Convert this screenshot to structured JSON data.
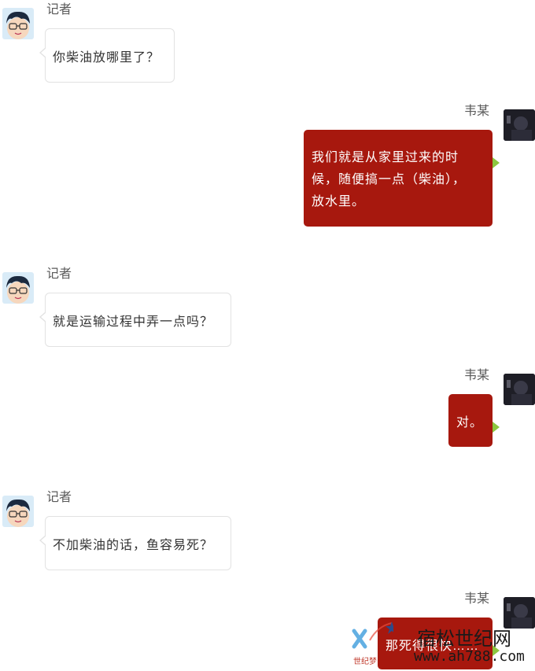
{
  "conversation": {
    "messages": [
      {
        "speaker": "记者",
        "side": "left",
        "lines": [
          "你柴油放哪里了？"
        ]
      },
      {
        "speaker": "韦某",
        "side": "right",
        "lines": [
          "我们就是从家里过来的时",
          "候，随便搞一点（柴油），",
          "放水里。"
        ]
      },
      {
        "speaker": "记者",
        "side": "left",
        "lines": [
          "就是运输过程中弄一点吗？"
        ]
      },
      {
        "speaker": "韦某",
        "side": "right",
        "lines": [
          "对。"
        ]
      },
      {
        "speaker": "记者",
        "side": "left",
        "lines": [
          "不加柴油的话，鱼容易死？"
        ]
      },
      {
        "speaker": "韦某",
        "side": "right",
        "lines": [
          "那死得很快……"
        ]
      }
    ]
  },
  "watermark": {
    "site_name": "宿松世纪网",
    "url": "www.ah788.com",
    "sub_text": "世纪梦"
  },
  "colors": {
    "right_bubble": "#a7180e",
    "right_tail": "#8cc63f",
    "left_bubble_border": "#e2e2e2"
  },
  "icons": {
    "left_avatar": "cartoon-boy-avatar-icon",
    "right_avatar": "dark-photo-avatar-icon"
  }
}
